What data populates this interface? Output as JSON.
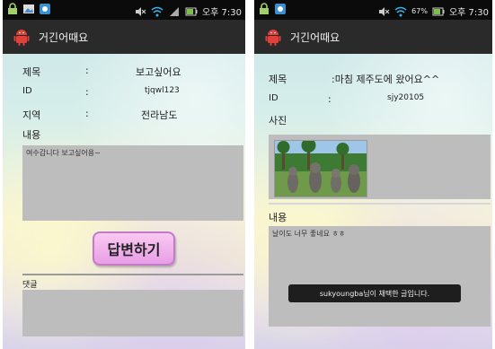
{
  "left": {
    "status": {
      "time": "오후 7:30"
    },
    "app_title": "거긴어때요",
    "fields": {
      "title_label": "제목",
      "title_sep": ":",
      "title_value": "보고싶어요",
      "id_label": "ID",
      "id_sep": ":",
      "id_value": "tjqwl123",
      "region_label": "지역",
      "region_sep": ":",
      "region_value": "전라남도",
      "content_label": "내용"
    },
    "content_text": "여수갑니다 보고싶어용~",
    "reply_button": "답변하기",
    "comment_label": "댓글"
  },
  "right": {
    "status": {
      "battery": "67%",
      "time": "오후 7:30"
    },
    "app_title": "거긴어때요",
    "fields": {
      "title_label": "제목",
      "title_value": ":마침 제주도에 왔어요^^",
      "id_label": "ID",
      "id_sep": ":",
      "id_value": "sjy20105",
      "photo_label": "사진",
      "content_label": "내용"
    },
    "content_text": "날이도 너무 좋네요 ㅎㅎ",
    "toast": "sukyoungba님이 채택한 글입니다."
  },
  "colors": {
    "titlebar": "#2a2a2a",
    "statusbar": "#0b0b0b",
    "gray_box": "#bdbdbd",
    "button": "#e8a0e6",
    "android_icon": "#e0413a"
  }
}
